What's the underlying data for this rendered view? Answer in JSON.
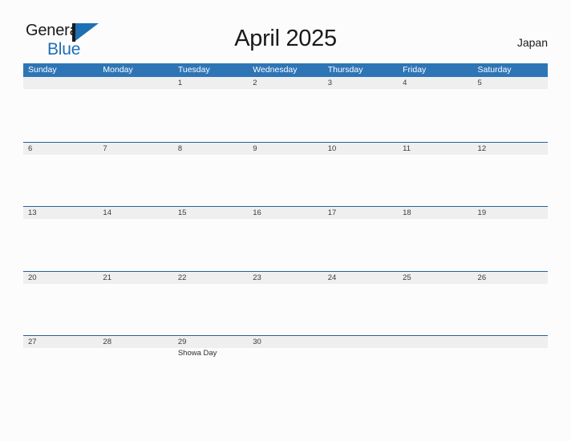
{
  "brand": {
    "word1": "General",
    "word2": "Blue",
    "mark": "flag-triangle",
    "color_primary": "#1f6fb5",
    "color_text": "#1a1a1a"
  },
  "header": {
    "title": "April 2025",
    "country": "Japan"
  },
  "theme": {
    "header_blue": "#2e75b6",
    "rule_blue": "#2a6099",
    "band_gray": "#efefef",
    "page_bg": "#fcfcfc"
  },
  "calendar": {
    "weekdays": [
      "Sunday",
      "Monday",
      "Tuesday",
      "Wednesday",
      "Thursday",
      "Friday",
      "Saturday"
    ],
    "weeks": [
      {
        "days": [
          {
            "date": "",
            "events": []
          },
          {
            "date": "",
            "events": []
          },
          {
            "date": "1",
            "events": []
          },
          {
            "date": "2",
            "events": []
          },
          {
            "date": "3",
            "events": []
          },
          {
            "date": "4",
            "events": []
          },
          {
            "date": "5",
            "events": []
          }
        ]
      },
      {
        "days": [
          {
            "date": "6",
            "events": []
          },
          {
            "date": "7",
            "events": []
          },
          {
            "date": "8",
            "events": []
          },
          {
            "date": "9",
            "events": []
          },
          {
            "date": "10",
            "events": []
          },
          {
            "date": "11",
            "events": []
          },
          {
            "date": "12",
            "events": []
          }
        ]
      },
      {
        "days": [
          {
            "date": "13",
            "events": []
          },
          {
            "date": "14",
            "events": []
          },
          {
            "date": "15",
            "events": []
          },
          {
            "date": "16",
            "events": []
          },
          {
            "date": "17",
            "events": []
          },
          {
            "date": "18",
            "events": []
          },
          {
            "date": "19",
            "events": []
          }
        ]
      },
      {
        "days": [
          {
            "date": "20",
            "events": []
          },
          {
            "date": "21",
            "events": []
          },
          {
            "date": "22",
            "events": []
          },
          {
            "date": "23",
            "events": []
          },
          {
            "date": "24",
            "events": []
          },
          {
            "date": "25",
            "events": []
          },
          {
            "date": "26",
            "events": []
          }
        ]
      },
      {
        "days": [
          {
            "date": "27",
            "events": []
          },
          {
            "date": "28",
            "events": []
          },
          {
            "date": "29",
            "events": [
              "Showa Day"
            ]
          },
          {
            "date": "30",
            "events": []
          },
          {
            "date": "",
            "events": []
          },
          {
            "date": "",
            "events": []
          },
          {
            "date": "",
            "events": []
          }
        ]
      }
    ]
  }
}
